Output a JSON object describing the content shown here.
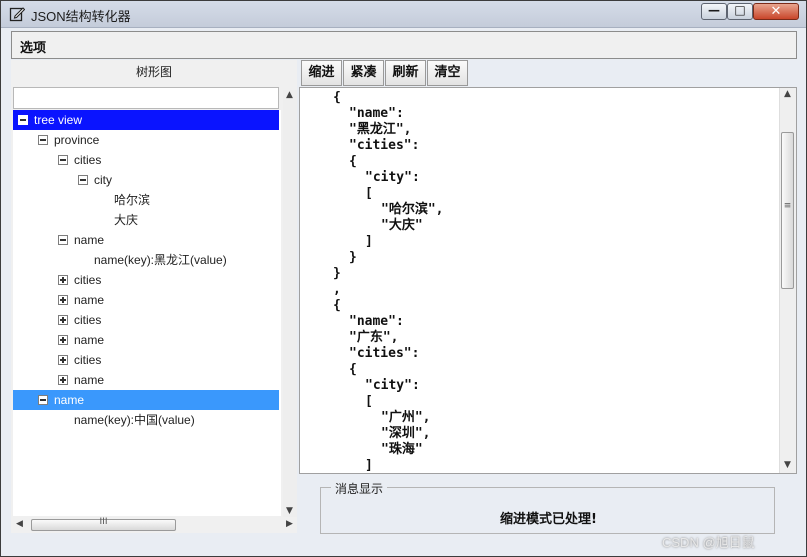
{
  "window": {
    "title": "JSON结构转化器",
    "controls": {
      "minimize": "—",
      "maximize": "□",
      "close": "✕"
    }
  },
  "menu": {
    "options_label": "选项"
  },
  "tree_panel": {
    "caption": "树形图",
    "search_value": "",
    "nodes": [
      {
        "label": "tree view",
        "indent": 0,
        "expander": "minus",
        "selected": "dark"
      },
      {
        "label": "province",
        "indent": 1,
        "expander": "minus"
      },
      {
        "label": "cities",
        "indent": 2,
        "expander": "minus"
      },
      {
        "label": "city",
        "indent": 3,
        "expander": "minus"
      },
      {
        "label": "哈尔滨",
        "indent": 4,
        "expander": "none"
      },
      {
        "label": "大庆",
        "indent": 4,
        "expander": "none"
      },
      {
        "label": "name",
        "indent": 2,
        "expander": "minus"
      },
      {
        "label": "name(key):黑龙江(value)",
        "indent": 3,
        "expander": "none"
      },
      {
        "label": "cities",
        "indent": 2,
        "expander": "plus"
      },
      {
        "label": "name",
        "indent": 2,
        "expander": "plus"
      },
      {
        "label": "cities",
        "indent": 2,
        "expander": "plus"
      },
      {
        "label": "name",
        "indent": 2,
        "expander": "plus"
      },
      {
        "label": "cities",
        "indent": 2,
        "expander": "plus"
      },
      {
        "label": "name",
        "indent": 2,
        "expander": "plus"
      },
      {
        "label": "name",
        "indent": 1,
        "expander": "minus",
        "selected": "light"
      },
      {
        "label": "name(key):中国(value)",
        "indent": 2,
        "expander": "none"
      }
    ],
    "hscroll_grip": "III"
  },
  "toolbar": {
    "indent_label": "缩进",
    "compact_label": "紧凑",
    "refresh_label": "刷新",
    "clear_label": "清空"
  },
  "json_text": {
    "lines": [
      {
        "text": "{",
        "indent": 0
      },
      {
        "text": "\"name\":",
        "indent": 1
      },
      {
        "text": "\"黑龙江\",",
        "indent": 1
      },
      {
        "text": "\"cities\":",
        "indent": 1
      },
      {
        "text": "{",
        "indent": 1
      },
      {
        "text": "\"city\":",
        "indent": 2
      },
      {
        "text": "[",
        "indent": 2
      },
      {
        "text": "\"哈尔滨\",",
        "indent": 3
      },
      {
        "text": "\"大庆\"",
        "indent": 3
      },
      {
        "text": "]",
        "indent": 2
      },
      {
        "text": "}",
        "indent": 1
      },
      {
        "text": "}",
        "indent": 0
      },
      {
        "text": ",",
        "indent": 0
      },
      {
        "text": "{",
        "indent": 0
      },
      {
        "text": "\"name\":",
        "indent": 1
      },
      {
        "text": "\"广东\",",
        "indent": 1
      },
      {
        "text": "\"cities\":",
        "indent": 1
      },
      {
        "text": "{",
        "indent": 1
      },
      {
        "text": "\"city\":",
        "indent": 2
      },
      {
        "text": "[",
        "indent": 2
      },
      {
        "text": "\"广州\",",
        "indent": 3
      },
      {
        "text": "\"深圳\",",
        "indent": 3
      },
      {
        "text": "\"珠海\"",
        "indent": 3
      },
      {
        "text": "]",
        "indent": 2
      }
    ],
    "vscroll_grip": "≡"
  },
  "message": {
    "legend": "消息显示",
    "text": "缩进模式已处理!"
  },
  "watermark": "CSDN @旭日鼠",
  "colors": {
    "tree_selected_dark": "#0a14ff",
    "tree_selected_light": "#3a98fc"
  }
}
